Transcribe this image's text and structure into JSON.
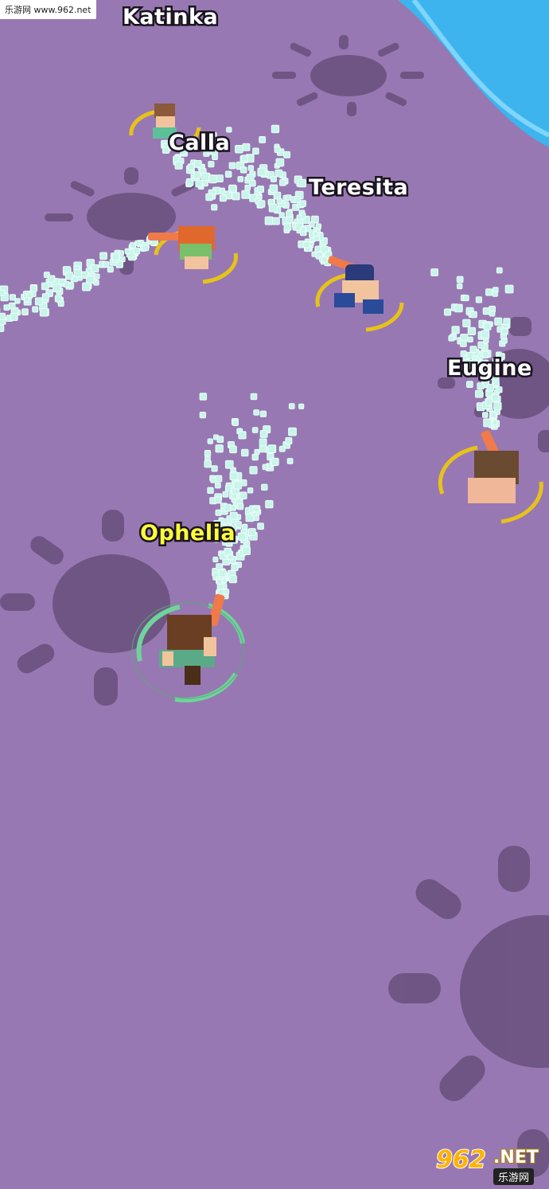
{
  "players": {
    "p1": {
      "name": "Katinka"
    },
    "p2": {
      "name": "Calla"
    },
    "p3": {
      "name": "Teresita"
    },
    "p4": {
      "name": "Eugine"
    },
    "me": {
      "name": "Ophelia"
    }
  },
  "watermark": {
    "text": "乐游网 www.962.net"
  },
  "logo": {
    "main": "962",
    "net": ".NET",
    "sub": "乐游网"
  },
  "colors": {
    "ground": "#9878b2",
    "sun_shadow": "#6b5280",
    "water": "#3db4ee",
    "spray": "#c9f4ea",
    "enemy_ring": "#e6c21a",
    "player_ring": "#6fd49a",
    "player_name": "#ffff3a"
  }
}
